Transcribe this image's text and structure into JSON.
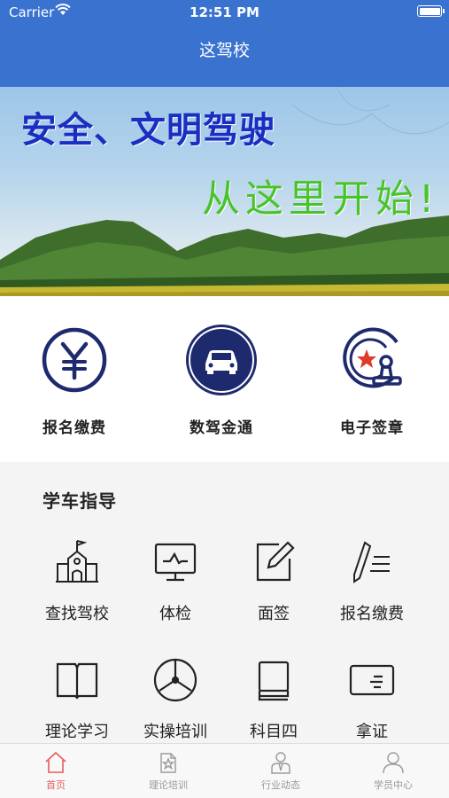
{
  "status_bar": {
    "carrier": "Carrier",
    "time": "12:51 PM"
  },
  "nav": {
    "title": "这驾校"
  },
  "banner": {
    "headline": "安全、文明驾驶",
    "tagline": "从这里开始!"
  },
  "quick_actions": [
    {
      "label": "报名缴费",
      "icon": "yen-icon"
    },
    {
      "label": "数驾金通",
      "icon": "car-icon"
    },
    {
      "label": "电子签章",
      "icon": "seal-stamp-icon"
    }
  ],
  "guide": {
    "title": "学车指导",
    "items": [
      {
        "label": "查找驾校",
        "icon": "school-building-icon"
      },
      {
        "label": "体检",
        "icon": "monitor-pulse-icon"
      },
      {
        "label": "面签",
        "icon": "edit-icon"
      },
      {
        "label": "报名缴费",
        "icon": "pen-list-icon"
      },
      {
        "label": "理论学习",
        "icon": "open-book-icon"
      },
      {
        "label": "实操培训",
        "icon": "steering-wheel-icon"
      },
      {
        "label": "科目四",
        "icon": "book-stack-icon"
      },
      {
        "label": "拿证",
        "icon": "card-icon"
      }
    ]
  },
  "tabs": [
    {
      "label": "首页",
      "icon": "home-icon",
      "active": true
    },
    {
      "label": "理论培训",
      "icon": "star-doc-icon",
      "active": false
    },
    {
      "label": "行业动态",
      "icon": "person-tie-icon",
      "active": false
    },
    {
      "label": "学员中心",
      "icon": "user-icon",
      "active": false
    }
  ],
  "colors": {
    "brand": "#3a72cf",
    "icon_dark": "#1e2a6e",
    "active_tab": "#e65d5d",
    "banner_red": "#e03a2a"
  }
}
